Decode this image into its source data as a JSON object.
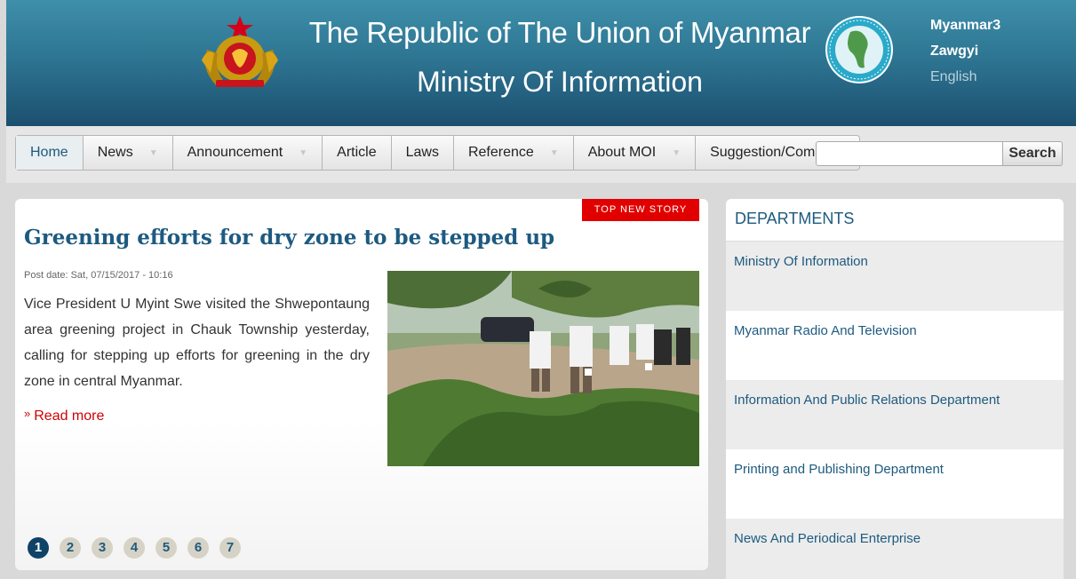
{
  "header": {
    "title_line1": "The Republic of The Union of Myanmar",
    "title_line2": "Ministry Of Information",
    "emblem_icon": "state-emblem-icon",
    "seal_icon": "ministry-seal-icon",
    "languages": [
      "Myanmar3",
      "Zawgyi",
      "English"
    ]
  },
  "nav": {
    "items": [
      {
        "label": "Home",
        "dropdown": false,
        "active": true
      },
      {
        "label": "News",
        "dropdown": true
      },
      {
        "label": "Announcement",
        "dropdown": true
      },
      {
        "label": "Article",
        "dropdown": false
      },
      {
        "label": "Laws",
        "dropdown": false
      },
      {
        "label": "Reference",
        "dropdown": true
      },
      {
        "label": "About MOI",
        "dropdown": true
      },
      {
        "label": "Suggestion/Complain",
        "dropdown": false
      }
    ],
    "search_value": "",
    "search_button": "Search"
  },
  "story": {
    "badge": "TOP NEW STORY",
    "title": "Greening efforts for dry zone to be stepped up",
    "post_date": "Post date: Sat, 07/15/2017 - 10:16",
    "body": "Vice President U Myint Swe visited the Shwepontaung area greening project in Chauk Township yesterday, calling for stepping up efforts for greening in the dry zone in central Myanmar.",
    "read_more": "Read more",
    "pages": [
      "1",
      "2",
      "3",
      "4",
      "5",
      "6",
      "7"
    ],
    "active_page": "1"
  },
  "departments": {
    "heading": "DEPARTMENTS",
    "items": [
      "Ministry Of Information",
      "Myanmar Radio And Television",
      "Information And Public Relations Department",
      "Printing and Publishing Department",
      "News And Periodical Enterprise"
    ]
  },
  "colors": {
    "header_top": "#3e8fa9",
    "header_bottom": "#1c4f6f",
    "link_blue": "#1d5a80",
    "badge_red": "#e10000",
    "read_more_red": "#d20000"
  }
}
